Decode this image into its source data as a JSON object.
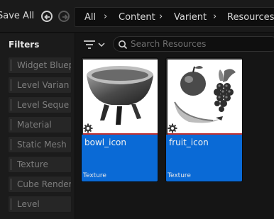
{
  "toolbar": {
    "save_all_label": "Save All"
  },
  "breadcrumbs": [
    "All",
    "Content",
    "Varient",
    "Resources"
  ],
  "filters": {
    "title": "Filters",
    "items": [
      "Widget Bluep",
      "Level Varian",
      "Level Seque",
      "Material",
      "Static Mesh",
      "Texture",
      "Cube Render",
      "Level"
    ]
  },
  "search": {
    "placeholder": "Search Resources"
  },
  "assets": [
    {
      "name": "bowl_icon",
      "type": "Texture",
      "thumbnail": "bowl"
    },
    {
      "name": "fruit_icon",
      "type": "Texture",
      "thumbnail": "fruit"
    }
  ],
  "colors": {
    "selection": "#0a6ad6",
    "texture_strip": "#c03030"
  }
}
